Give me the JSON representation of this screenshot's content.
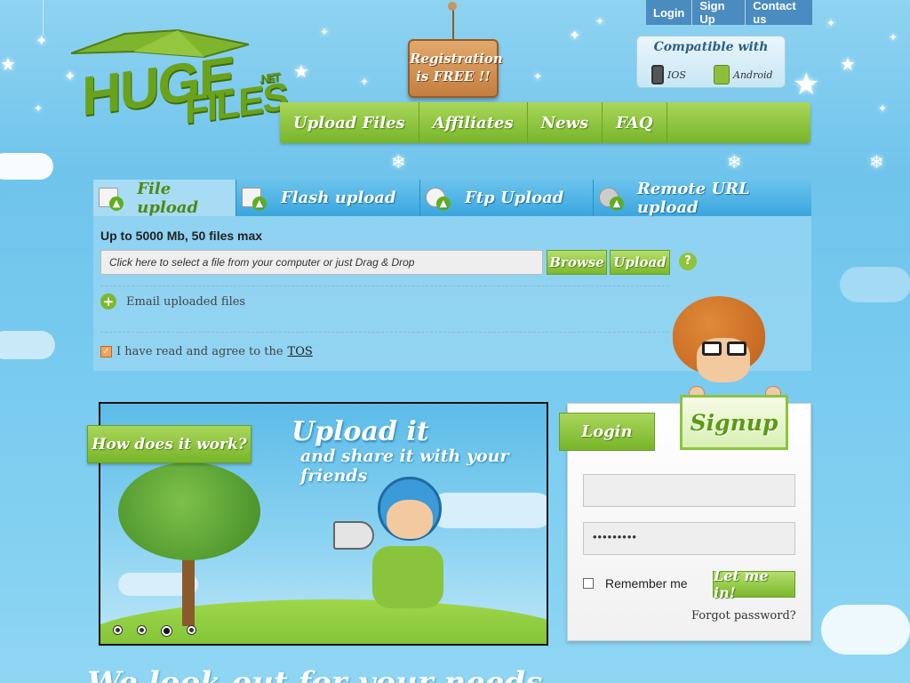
{
  "top_links": [
    "Login",
    "Sign Up",
    "Contact us"
  ],
  "logo": {
    "word1": "HUGE",
    "word2": "FILES",
    "tld": ".NET"
  },
  "registration_sign": {
    "line1": "Registration",
    "line2": "is FREE !!"
  },
  "compatible": {
    "title": "Compatible with",
    "ios": "IOS",
    "android": "Android"
  },
  "main_nav": [
    "Upload Files",
    "Affiliates",
    "News",
    "FAQ"
  ],
  "upload_tabs": [
    "File upload",
    "Flash upload",
    "Ftp Upload",
    "Remote URL upload"
  ],
  "upload": {
    "limits": "Up to 5000 Mb, 50 files max",
    "file_field": "Click here to select a file from your computer or just Drag & Drop",
    "browse_label": "Browse",
    "upload_label": "Upload",
    "email_label": "Email uploaded files",
    "tos_prefix": "I have read and agree to the",
    "tos_link": "TOS",
    "tos_checked": true
  },
  "slider": {
    "banner": "How does it work?",
    "headline": "Upload it",
    "subline": "and share it with your friends",
    "slide_count": 4,
    "active_slide": 3
  },
  "login": {
    "tab_label": "Login",
    "signup_label": "Signup",
    "username_value": "",
    "password_value": "•••••••••",
    "remember_label": "Remember me",
    "submit_label": "Let me in!",
    "forgot_label": "Forgot password?"
  },
  "bottom_heading": "We look out for your needs",
  "colors": {
    "green": "#7cb82e",
    "sky": "#6fc4ec",
    "tab_blue": "#3aa6de"
  }
}
